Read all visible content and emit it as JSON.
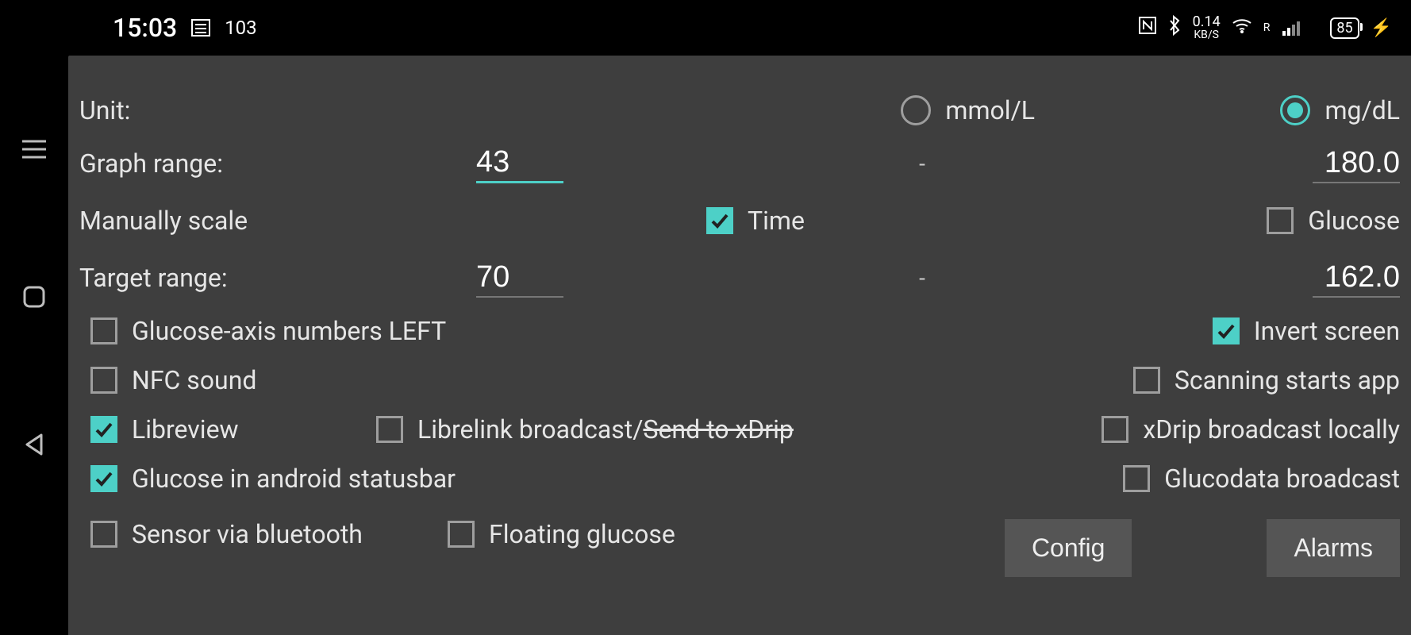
{
  "status": {
    "time": "15:03",
    "notif_count": "103",
    "net_speed_value": "0.14",
    "net_speed_unit": "KB/S",
    "signal_label": "R",
    "battery": "85"
  },
  "unit": {
    "label": "Unit:",
    "opt1": "mmol/L",
    "opt2": "mg/dL",
    "selected": "mg/dL"
  },
  "graph_range": {
    "label": "Graph range:",
    "min": "43",
    "max": "180.0"
  },
  "manual_scale": {
    "label": "Manually scale",
    "time_label": "Time",
    "time_checked": true,
    "glucose_label": "Glucose",
    "glucose_checked": false
  },
  "target_range": {
    "label": "Target range:",
    "min": "70",
    "max": "162.0"
  },
  "checks": {
    "glucose_axis_left": {
      "label": "Glucose-axis numbers LEFT",
      "checked": false
    },
    "invert_screen": {
      "label": "Invert screen",
      "checked": true
    },
    "nfc_sound": {
      "label": "NFC sound",
      "checked": false
    },
    "scan_starts": {
      "label": "Scanning starts app",
      "checked": false
    },
    "libreview": {
      "label": "Libreview",
      "checked": true
    },
    "librelink_bc_prefix": "Librelink broadcast/",
    "librelink_bc_strike": "Send to xDrip",
    "librelink_bc": {
      "checked": false
    },
    "xdrip_local": {
      "label": "xDrip broadcast locally",
      "checked": false
    },
    "glucose_statusbar": {
      "label": "Glucose in android statusbar",
      "checked": true
    },
    "glucodata_bc": {
      "label": "Glucodata broadcast",
      "checked": false
    },
    "sensor_bt": {
      "label": "Sensor via bluetooth",
      "checked": false
    },
    "floating_glucose": {
      "label": "Floating glucose",
      "checked": false
    }
  },
  "buttons": {
    "config": "Config",
    "alarms": "Alarms"
  }
}
